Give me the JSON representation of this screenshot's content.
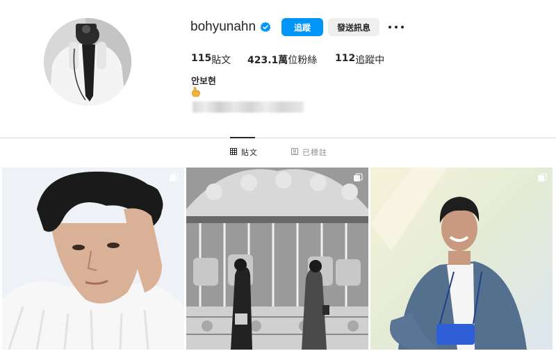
{
  "profile": {
    "username": "bohyunahn",
    "follow_label": "追蹤",
    "message_label": "發送訊息",
    "name": "안보현"
  },
  "stats": {
    "posts_count": "115",
    "posts_label": "貼文",
    "followers_count": "423.1萬",
    "followers_label": "位粉絲",
    "following_count": "112",
    "following_label": "追蹤中"
  },
  "tabs": [
    {
      "label": "貼文",
      "icon": "grid-icon",
      "active": true
    },
    {
      "label": "已標註",
      "icon": "tag-portrait-icon",
      "active": false
    }
  ],
  "posts": [
    {
      "icon": "multi-photo-icon"
    },
    {
      "icon": "multi-photo-icon"
    },
    {
      "icon": "multi-photo-icon"
    }
  ],
  "colors": {
    "accent": "#0095f6",
    "verified": "#0095f6",
    "text": "#262626",
    "muted": "#8e8e8e",
    "divider": "#dbdbdb"
  }
}
